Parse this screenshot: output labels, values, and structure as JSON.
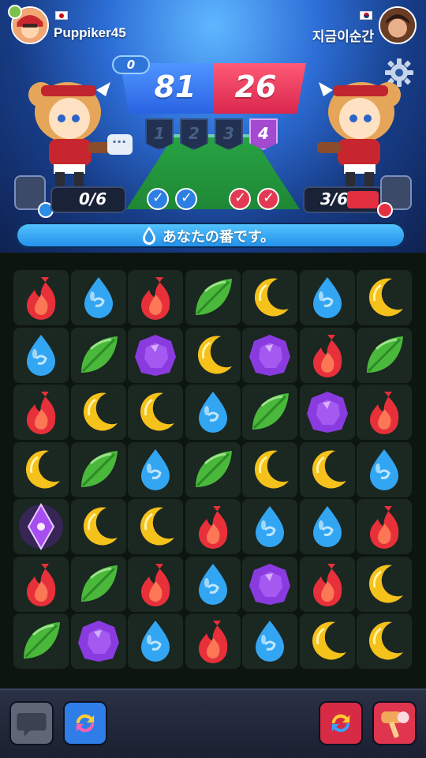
{
  "players": {
    "left": {
      "name": "Puppiker45",
      "country": "JP",
      "energy_text": "0/6",
      "energy_value": 0,
      "energy_max": 6,
      "element": "water",
      "rounds_won_marks": 2
    },
    "right": {
      "name": "지금이순간",
      "country": "KR",
      "energy_text": "3/6",
      "energy_value": 3,
      "energy_max": 6,
      "element": "fire",
      "rounds_won_marks": 2
    }
  },
  "score": {
    "left": "81",
    "right": "26",
    "round_badge": "0"
  },
  "turns": [
    "1",
    "2",
    "3",
    "4"
  ],
  "active_turn_index": 3,
  "banner": {
    "message": "あなたの番です。"
  },
  "board": {
    "rows": [
      [
        "fire",
        "water",
        "fire",
        "leaf",
        "moon",
        "water",
        "moon"
      ],
      [
        "water",
        "leaf",
        "gem",
        "moon",
        "gem",
        "fire",
        "leaf"
      ],
      [
        "fire",
        "moon",
        "moon",
        "water",
        "leaf",
        "gem",
        "fire"
      ],
      [
        "moon",
        "leaf",
        "water",
        "leaf",
        "moon",
        "moon",
        "water"
      ],
      [
        "crystal",
        "moon",
        "moon",
        "fire",
        "water",
        "water",
        "fire"
      ],
      [
        "fire",
        "leaf",
        "fire",
        "water",
        "gem",
        "fire",
        "moon"
      ],
      [
        "leaf",
        "gem",
        "water",
        "fire",
        "water",
        "moon",
        "moon"
      ]
    ]
  },
  "colors": {
    "water": "#33a6f3",
    "fire": "#e8303a",
    "leaf": "#49b83b",
    "moon": "#f5c11b",
    "gem": "#8a3be0",
    "blue_team": "#2a63e2",
    "red_team": "#d9274d"
  },
  "bottom_buttons": [
    {
      "name": "emote-button",
      "icon": "speech-bubble-icon"
    },
    {
      "name": "swap-blue-button",
      "icon": "refresh-blue-icon"
    },
    {
      "name": "swap-red-button",
      "icon": "refresh-red-icon"
    },
    {
      "name": "hammer-button",
      "icon": "hammer-icon"
    }
  ]
}
